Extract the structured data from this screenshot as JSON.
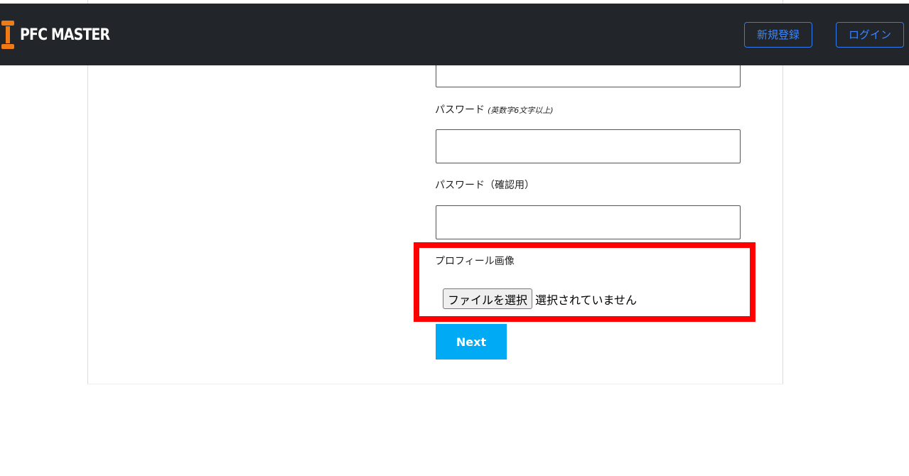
{
  "header": {
    "brand": "PFC MASTER",
    "signup_label": "新規登録",
    "login_label": "ログイン"
  },
  "form": {
    "password_label": "パスワード",
    "password_note": "(英数字6文字以上)",
    "password_confirm_label": "パスワード（確認用）",
    "profile_image_label": "プロフィール画像",
    "file_button_label": "ファイルを選択",
    "file_status": "選択されていません",
    "next_label": "Next"
  },
  "colors": {
    "navbar_bg": "#222529",
    "brand_accent": "#f07a13",
    "nav_button": "#3a86ff",
    "next_button": "#00aaf5",
    "highlight": "#ff0000"
  }
}
